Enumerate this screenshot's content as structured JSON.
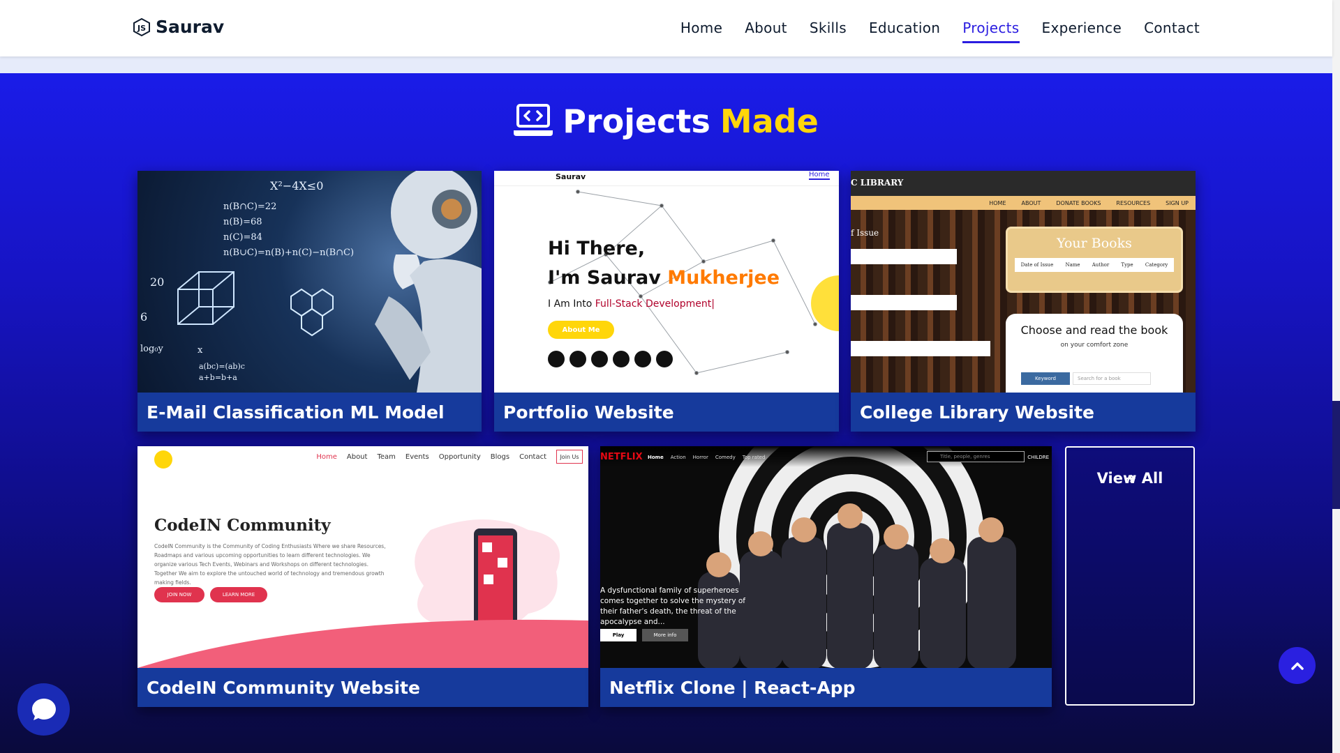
{
  "header": {
    "logo_text": "Saurav",
    "nav": [
      {
        "label": "Home",
        "active": false
      },
      {
        "label": "About",
        "active": false
      },
      {
        "label": "Skills",
        "active": false
      },
      {
        "label": "Education",
        "active": false
      },
      {
        "label": "Projects",
        "active": true
      },
      {
        "label": "Experience",
        "active": false
      },
      {
        "label": "Contact",
        "active": false
      }
    ],
    "active_color": "#2a1ce0"
  },
  "section": {
    "title_word": "Projects",
    "title_accent": "Made",
    "accent_color": "#ffd60a",
    "icon": "laptop-code-icon"
  },
  "projects": [
    {
      "title": "E-Mail Classification ML Model"
    },
    {
      "title": "Portfolio Website"
    },
    {
      "title": "College Library Website"
    },
    {
      "title": "CodeIN Community Website"
    },
    {
      "title": "Netflix Clone | React-App"
    }
  ],
  "view_all": {
    "label": "View All"
  },
  "previews": {
    "ml": {
      "lines": [
        "X²−4X≤0",
        "n(B∩C)=22",
        "n(B)=68",
        "n(C)=84",
        "n(B∪C)=n(B)+n(C)−n(B∩C)",
        "20",
        "6",
        "log₀y",
        "x",
        "a(bc)=(ab)c",
        "a+b=b+a"
      ]
    },
    "portfolio": {
      "logo": "Saurav",
      "nav_active": "Home",
      "greeting": "Hi There,",
      "name_prefix": "I'm Saurav ",
      "name_accent": "Mukherjee",
      "tagline_prefix": "I Am Into ",
      "tagline_accent": "Full-Stack Development|",
      "button": "About Me"
    },
    "library": {
      "brand": "C LIBRARY",
      "nav": [
        "HOME",
        "ABOUT",
        "DONATE BOOKS",
        "RESOURCES",
        "SIGN UP"
      ],
      "form_label": "f Issue",
      "books_title": "Your Books",
      "books_cols": [
        "Date of Issue",
        "Name",
        "Author",
        "Type",
        "Category"
      ],
      "choose_title": "Choose and read the book",
      "choose_sub": "on your comfort zone",
      "keyword_btn": "Keyword",
      "search_placeholder": "Search for a book"
    },
    "codein": {
      "nav": [
        "Home",
        "About",
        "Team",
        "Events",
        "Opportunity",
        "Blogs",
        "Contact"
      ],
      "join_btn": "Join Us",
      "title": "CodeIN Community",
      "body": "CodeIN Community is the Community of Coding Enthusiasts Where we share Resources, Roadmaps and various upcoming opportunities to learn different technologies. We organize various Tech Events, Webinars and Workshops on different technologies. Together We aim to explore the untouched world of technology and tremendous growth making fields.",
      "btn_join": "JOIN NOW",
      "btn_learn": "LEARN MORE"
    },
    "netflix": {
      "brand": "NETFLIX",
      "nav": [
        "Home",
        "Action",
        "Horror",
        "Comedy",
        "Top rated"
      ],
      "search_placeholder": "Title, people, genres",
      "kids": "CHILDRE",
      "desc": "A dysfunctional family of superheroes comes together to solve the mystery of their father's death, the threat of the apocalypse and...",
      "play": "Play",
      "more": "More info"
    }
  }
}
